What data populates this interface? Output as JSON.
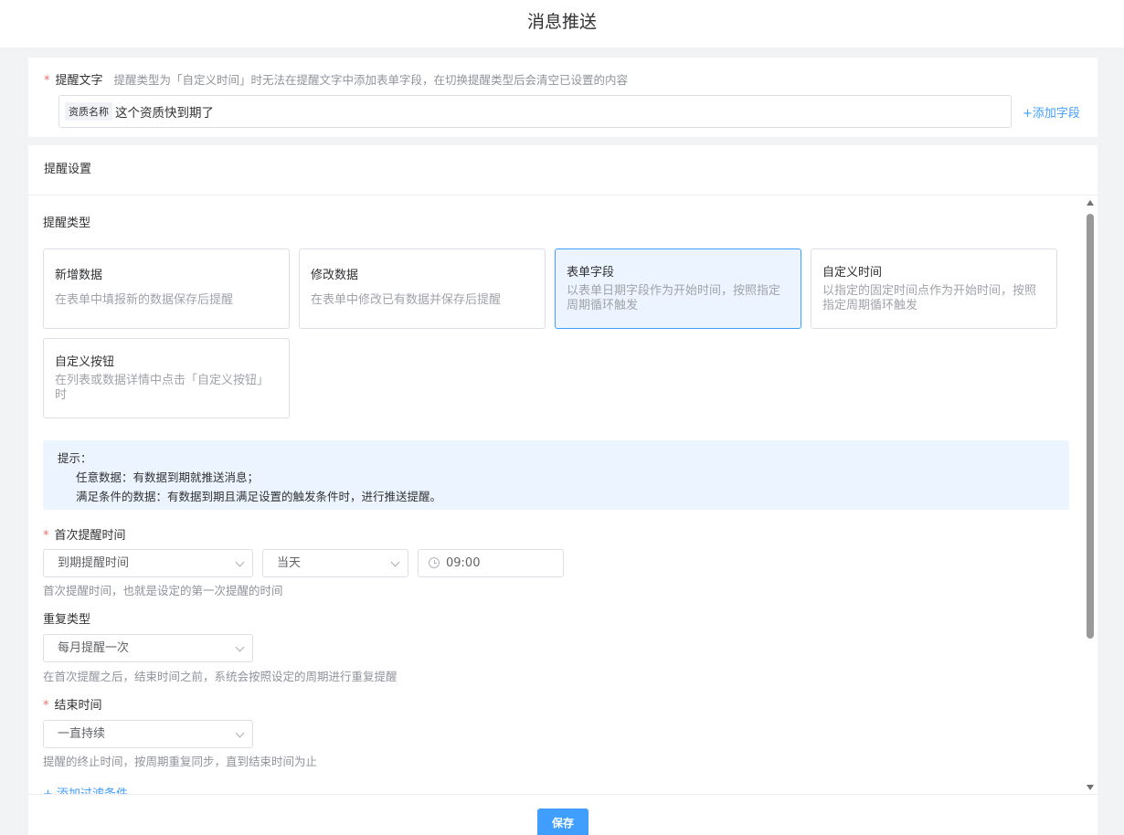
{
  "page": {
    "title": "消息推送"
  },
  "reminder_text": {
    "label": "提醒文字",
    "hint": "提醒类型为「自定义时间」时无法在提醒文字中添加表单字段，在切换提醒类型后会清空已设置的内容",
    "field_tag": "资质名称",
    "content": "这个资质快到期了",
    "add_field_label": "+添加字段"
  },
  "settings": {
    "header": "提醒设置",
    "type_section_title": "提醒类型",
    "types": [
      {
        "title": "新增数据",
        "desc": "在表单中填报新的数据保存后提醒",
        "selected": false
      },
      {
        "title": "修改数据",
        "desc": "在表单中修改已有数据并保存后提醒",
        "selected": false
      },
      {
        "title": "表单字段",
        "desc": "以表单日期字段作为开始时间，按照指定周期循环触发",
        "selected": true
      },
      {
        "title": "自定义时间",
        "desc": "以指定的固定时间点作为开始时间，按照指定周期循环触发",
        "selected": false
      },
      {
        "title": "自定义按钮",
        "desc": "在列表或数据详情中点击「自定义按钮」时",
        "selected": false
      }
    ],
    "tip": {
      "title": "提示：",
      "line1": "任意数据：有数据到期就推送消息；",
      "line2": "满足条件的数据：有数据到期且满足设置的触发条件时，进行推送提醒。"
    },
    "first_reminder": {
      "label": "首次提醒时间",
      "field_value": "到期提醒时间",
      "day_value": "当天",
      "time_value": "09:00",
      "help": "首次提醒时间，也就是设定的第一次提醒的时间"
    },
    "repeat": {
      "label": "重复类型",
      "value": "每月提醒一次",
      "help": "在首次提醒之后，结束时间之前，系统会按照设定的周期进行重复提醒"
    },
    "end_time": {
      "label": "结束时间",
      "value": "一直持续",
      "help": "提醒的终止时间，按周期重复同步，直到结束时间为止"
    },
    "add_filter_label": "+ 添加过滤条件"
  },
  "footer": {
    "save_label": "保存"
  },
  "colors": {
    "primary": "#409eff",
    "selected_bg": "#ecf5ff",
    "required": "#f56c6c"
  }
}
